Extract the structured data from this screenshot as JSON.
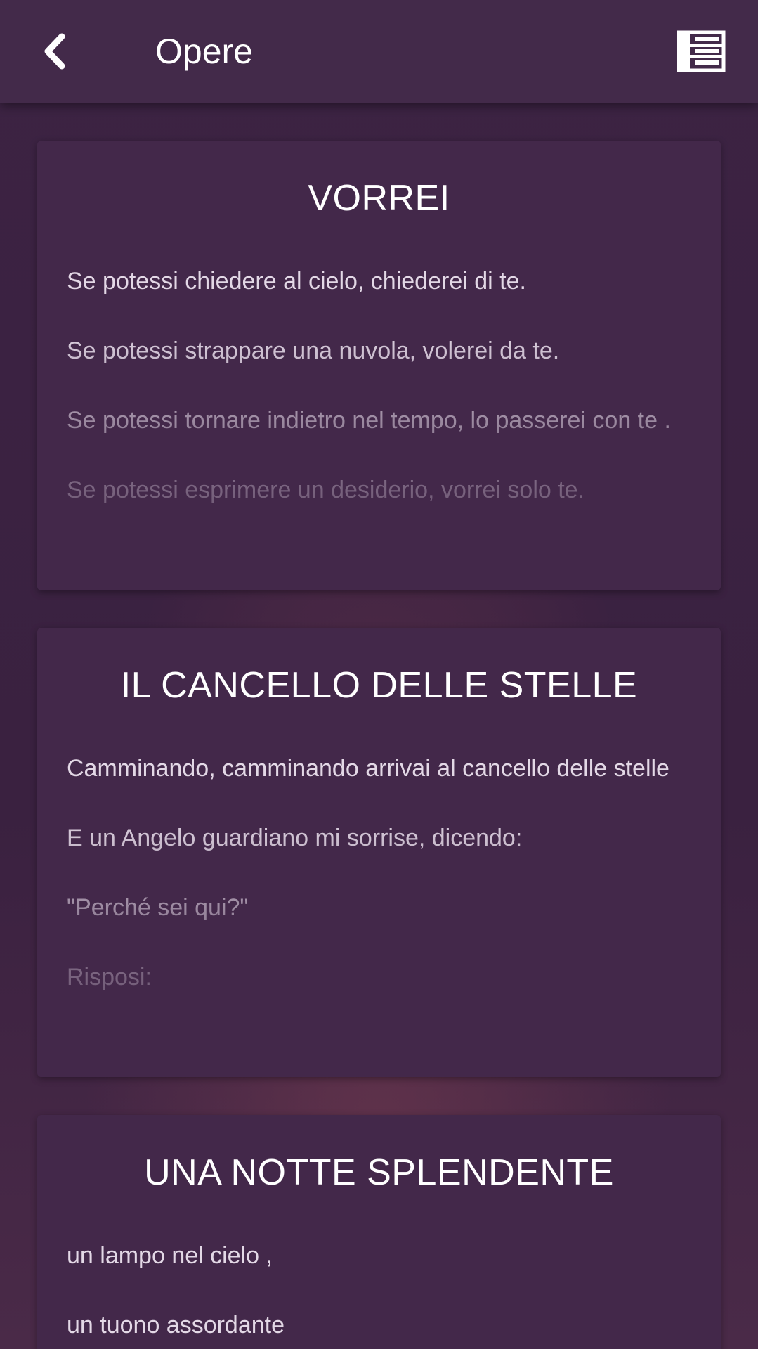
{
  "header": {
    "title": "Opere",
    "back_icon": "chevron-left-icon",
    "list_icon": "list-view-icon"
  },
  "cards": [
    {
      "title": "VORREI",
      "lines": [
        "Se potessi chiedere al cielo, chiederei di te.",
        "Se potessi strappare una nuvola, volerei da te.",
        "Se potessi tornare indietro nel tempo, lo passerei con te .",
        "Se potessi esprimere un desiderio, vorrei solo te."
      ]
    },
    {
      "title": "IL CANCELLO DELLE STELLE",
      "lines": [
        "Camminando, camminando arrivai al cancello delle stelle",
        "E un Angelo guardiano mi sorrise, dicendo:",
        "\"Perché sei qui?\"",
        "Risposi:"
      ]
    },
    {
      "title": "UNA NOTTE SPLENDENTE",
      "lines": [
        "un lampo nel cielo ,",
        "un tuono assordante"
      ]
    }
  ],
  "colors": {
    "background": "#3c2343",
    "header_bg": "#432a4a",
    "card_bg": "#43284a",
    "text_primary": "#ffffff",
    "text_body": "#e3d8e6"
  }
}
